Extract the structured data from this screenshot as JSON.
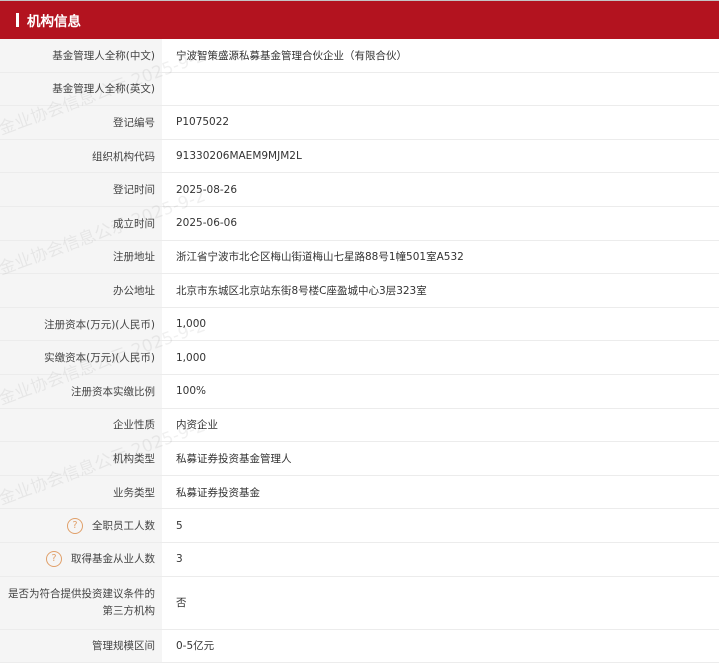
{
  "section": {
    "title": "机构信息"
  },
  "rows": [
    {
      "label": "基金管理人全称(中文)",
      "value": "宁波智策盛源私募基金管理合伙企业（有限合伙）"
    },
    {
      "label": "基金管理人全称(英文)",
      "value": ""
    },
    {
      "label": "登记编号",
      "value": "P1075022"
    },
    {
      "label": "组织机构代码",
      "value": "91330206MAEM9MJM2L"
    },
    {
      "label": "登记时间",
      "value": "2025-08-26"
    },
    {
      "label": "成立时间",
      "value": "2025-06-06"
    },
    {
      "label": "注册地址",
      "value": "浙江省宁波市北仑区梅山街道梅山七星路88号1幢501室A532"
    },
    {
      "label": "办公地址",
      "value": "北京市东城区北京站东街8号楼C座盈城中心3层323室"
    },
    {
      "label": "注册资本(万元)(人民币)",
      "value": "1,000"
    },
    {
      "label": "实缴资本(万元)(人民币)",
      "value": "1,000"
    },
    {
      "label": "注册资本实缴比例",
      "value": "100%"
    },
    {
      "label": "企业性质",
      "value": "内资企业"
    },
    {
      "label": "机构类型",
      "value": "私募证券投资基金管理人"
    },
    {
      "label": "业务类型",
      "value": "私募证券投资基金"
    },
    {
      "label": "全职员工人数",
      "value": "5",
      "help": "?"
    },
    {
      "label": "取得基金从业人数",
      "value": "3",
      "help": "?"
    },
    {
      "label": "是否为符合提供投资建议条件的第三方机构",
      "value": "否"
    },
    {
      "label": "管理规模区间",
      "value": "0-5亿元"
    }
  ],
  "watermark": {
    "text": "金业协会信息公示 2025-9-2"
  },
  "colors": {
    "header_bg": "#b3131f",
    "label_bg": "#f5f5f5",
    "help_icon": "#e0a06a"
  }
}
